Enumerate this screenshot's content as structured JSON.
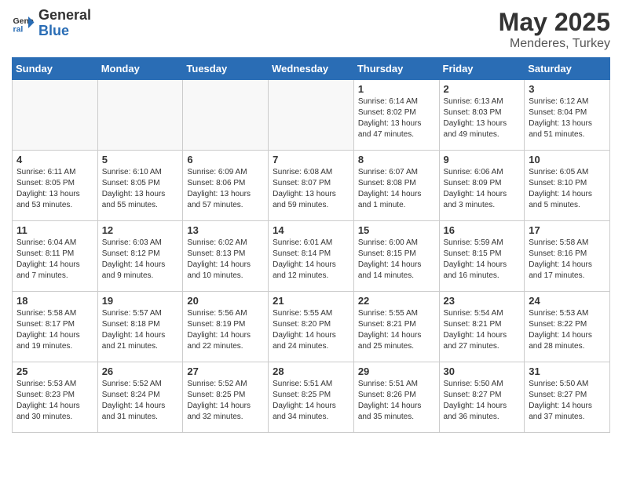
{
  "header": {
    "logo_general": "General",
    "logo_blue": "Blue",
    "title": "May 2025",
    "location": "Menderes, Turkey"
  },
  "days_of_week": [
    "Sunday",
    "Monday",
    "Tuesday",
    "Wednesday",
    "Thursday",
    "Friday",
    "Saturday"
  ],
  "weeks": [
    [
      {
        "day": "",
        "info": ""
      },
      {
        "day": "",
        "info": ""
      },
      {
        "day": "",
        "info": ""
      },
      {
        "day": "",
        "info": ""
      },
      {
        "day": "1",
        "info": "Sunrise: 6:14 AM\nSunset: 8:02 PM\nDaylight: 13 hours and 47 minutes."
      },
      {
        "day": "2",
        "info": "Sunrise: 6:13 AM\nSunset: 8:03 PM\nDaylight: 13 hours and 49 minutes."
      },
      {
        "day": "3",
        "info": "Sunrise: 6:12 AM\nSunset: 8:04 PM\nDaylight: 13 hours and 51 minutes."
      }
    ],
    [
      {
        "day": "4",
        "info": "Sunrise: 6:11 AM\nSunset: 8:05 PM\nDaylight: 13 hours and 53 minutes."
      },
      {
        "day": "5",
        "info": "Sunrise: 6:10 AM\nSunset: 8:05 PM\nDaylight: 13 hours and 55 minutes."
      },
      {
        "day": "6",
        "info": "Sunrise: 6:09 AM\nSunset: 8:06 PM\nDaylight: 13 hours and 57 minutes."
      },
      {
        "day": "7",
        "info": "Sunrise: 6:08 AM\nSunset: 8:07 PM\nDaylight: 13 hours and 59 minutes."
      },
      {
        "day": "8",
        "info": "Sunrise: 6:07 AM\nSunset: 8:08 PM\nDaylight: 14 hours and 1 minute."
      },
      {
        "day": "9",
        "info": "Sunrise: 6:06 AM\nSunset: 8:09 PM\nDaylight: 14 hours and 3 minutes."
      },
      {
        "day": "10",
        "info": "Sunrise: 6:05 AM\nSunset: 8:10 PM\nDaylight: 14 hours and 5 minutes."
      }
    ],
    [
      {
        "day": "11",
        "info": "Sunrise: 6:04 AM\nSunset: 8:11 PM\nDaylight: 14 hours and 7 minutes."
      },
      {
        "day": "12",
        "info": "Sunrise: 6:03 AM\nSunset: 8:12 PM\nDaylight: 14 hours and 9 minutes."
      },
      {
        "day": "13",
        "info": "Sunrise: 6:02 AM\nSunset: 8:13 PM\nDaylight: 14 hours and 10 minutes."
      },
      {
        "day": "14",
        "info": "Sunrise: 6:01 AM\nSunset: 8:14 PM\nDaylight: 14 hours and 12 minutes."
      },
      {
        "day": "15",
        "info": "Sunrise: 6:00 AM\nSunset: 8:15 PM\nDaylight: 14 hours and 14 minutes."
      },
      {
        "day": "16",
        "info": "Sunrise: 5:59 AM\nSunset: 8:15 PM\nDaylight: 14 hours and 16 minutes."
      },
      {
        "day": "17",
        "info": "Sunrise: 5:58 AM\nSunset: 8:16 PM\nDaylight: 14 hours and 17 minutes."
      }
    ],
    [
      {
        "day": "18",
        "info": "Sunrise: 5:58 AM\nSunset: 8:17 PM\nDaylight: 14 hours and 19 minutes."
      },
      {
        "day": "19",
        "info": "Sunrise: 5:57 AM\nSunset: 8:18 PM\nDaylight: 14 hours and 21 minutes."
      },
      {
        "day": "20",
        "info": "Sunrise: 5:56 AM\nSunset: 8:19 PM\nDaylight: 14 hours and 22 minutes."
      },
      {
        "day": "21",
        "info": "Sunrise: 5:55 AM\nSunset: 8:20 PM\nDaylight: 14 hours and 24 minutes."
      },
      {
        "day": "22",
        "info": "Sunrise: 5:55 AM\nSunset: 8:21 PM\nDaylight: 14 hours and 25 minutes."
      },
      {
        "day": "23",
        "info": "Sunrise: 5:54 AM\nSunset: 8:21 PM\nDaylight: 14 hours and 27 minutes."
      },
      {
        "day": "24",
        "info": "Sunrise: 5:53 AM\nSunset: 8:22 PM\nDaylight: 14 hours and 28 minutes."
      }
    ],
    [
      {
        "day": "25",
        "info": "Sunrise: 5:53 AM\nSunset: 8:23 PM\nDaylight: 14 hours and 30 minutes."
      },
      {
        "day": "26",
        "info": "Sunrise: 5:52 AM\nSunset: 8:24 PM\nDaylight: 14 hours and 31 minutes."
      },
      {
        "day": "27",
        "info": "Sunrise: 5:52 AM\nSunset: 8:25 PM\nDaylight: 14 hours and 32 minutes."
      },
      {
        "day": "28",
        "info": "Sunrise: 5:51 AM\nSunset: 8:25 PM\nDaylight: 14 hours and 34 minutes."
      },
      {
        "day": "29",
        "info": "Sunrise: 5:51 AM\nSunset: 8:26 PM\nDaylight: 14 hours and 35 minutes."
      },
      {
        "day": "30",
        "info": "Sunrise: 5:50 AM\nSunset: 8:27 PM\nDaylight: 14 hours and 36 minutes."
      },
      {
        "day": "31",
        "info": "Sunrise: 5:50 AM\nSunset: 8:27 PM\nDaylight: 14 hours and 37 minutes."
      }
    ]
  ]
}
